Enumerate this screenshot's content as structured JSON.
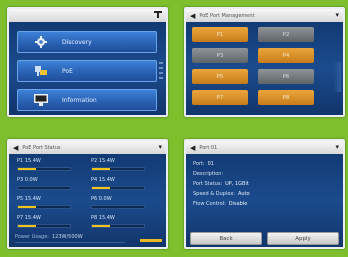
{
  "panel_main": {
    "signal_icon": "antenna-signal-icon",
    "items": [
      {
        "label": "Discovery",
        "icon": "gear-icon"
      },
      {
        "label": "PoE",
        "icon": "network-plug-icon"
      },
      {
        "label": "Information",
        "icon": "monitor-icon"
      }
    ]
  },
  "panel_ports": {
    "title": "PoE Port Management",
    "ports": [
      {
        "label": "P1",
        "state": "active",
        "color": "#d88f2a"
      },
      {
        "label": "P2",
        "state": "inactive",
        "color": "#777c81"
      },
      {
        "label": "P3",
        "state": "inactive",
        "color": "#777c81"
      },
      {
        "label": "P4",
        "state": "active",
        "color": "#d88f2a"
      },
      {
        "label": "P5",
        "state": "active",
        "color": "#d88f2a"
      },
      {
        "label": "P6",
        "state": "inactive",
        "color": "#777c81"
      },
      {
        "label": "P7",
        "state": "active",
        "color": "#d88f2a"
      },
      {
        "label": "P8",
        "state": "active",
        "color": "#d88f2a"
      }
    ]
  },
  "panel_status": {
    "title": "PoE Port Status",
    "stats": [
      {
        "label": "P1  15.4W",
        "fill": 0.35
      },
      {
        "label": "P2  15.4W",
        "fill": 0.35
      },
      {
        "label": "P3  0.0W",
        "fill": 0.0
      },
      {
        "label": "P4  15.4W",
        "fill": 0.35
      },
      {
        "label": "P5  15.4W",
        "fill": 0.35
      },
      {
        "label": "P6  0.0W",
        "fill": 0.0
      },
      {
        "label": "P7  15.4W",
        "fill": 0.35
      },
      {
        "label": "P8  15.4W",
        "fill": 0.35
      }
    ],
    "budget_label": "Power Usage:",
    "budget_value": "123W/500W"
  },
  "panel_port": {
    "title": "Port 01",
    "rows": [
      {
        "k": "Port:",
        "v": "01"
      },
      {
        "k": "Description:",
        "v": ""
      },
      {
        "k": "Port Status:",
        "v": "UP, 1GBit"
      },
      {
        "k": "Speed & Duplex:",
        "v": "Auto"
      },
      {
        "k": "Flow Control:",
        "v": "Disable"
      }
    ],
    "btn_left": "Back",
    "btn_right": "Apply"
  },
  "colors": {
    "background": "#7dbf2c",
    "accent_orange": "#d88f2a",
    "bar_yellow": "#f0c419"
  }
}
